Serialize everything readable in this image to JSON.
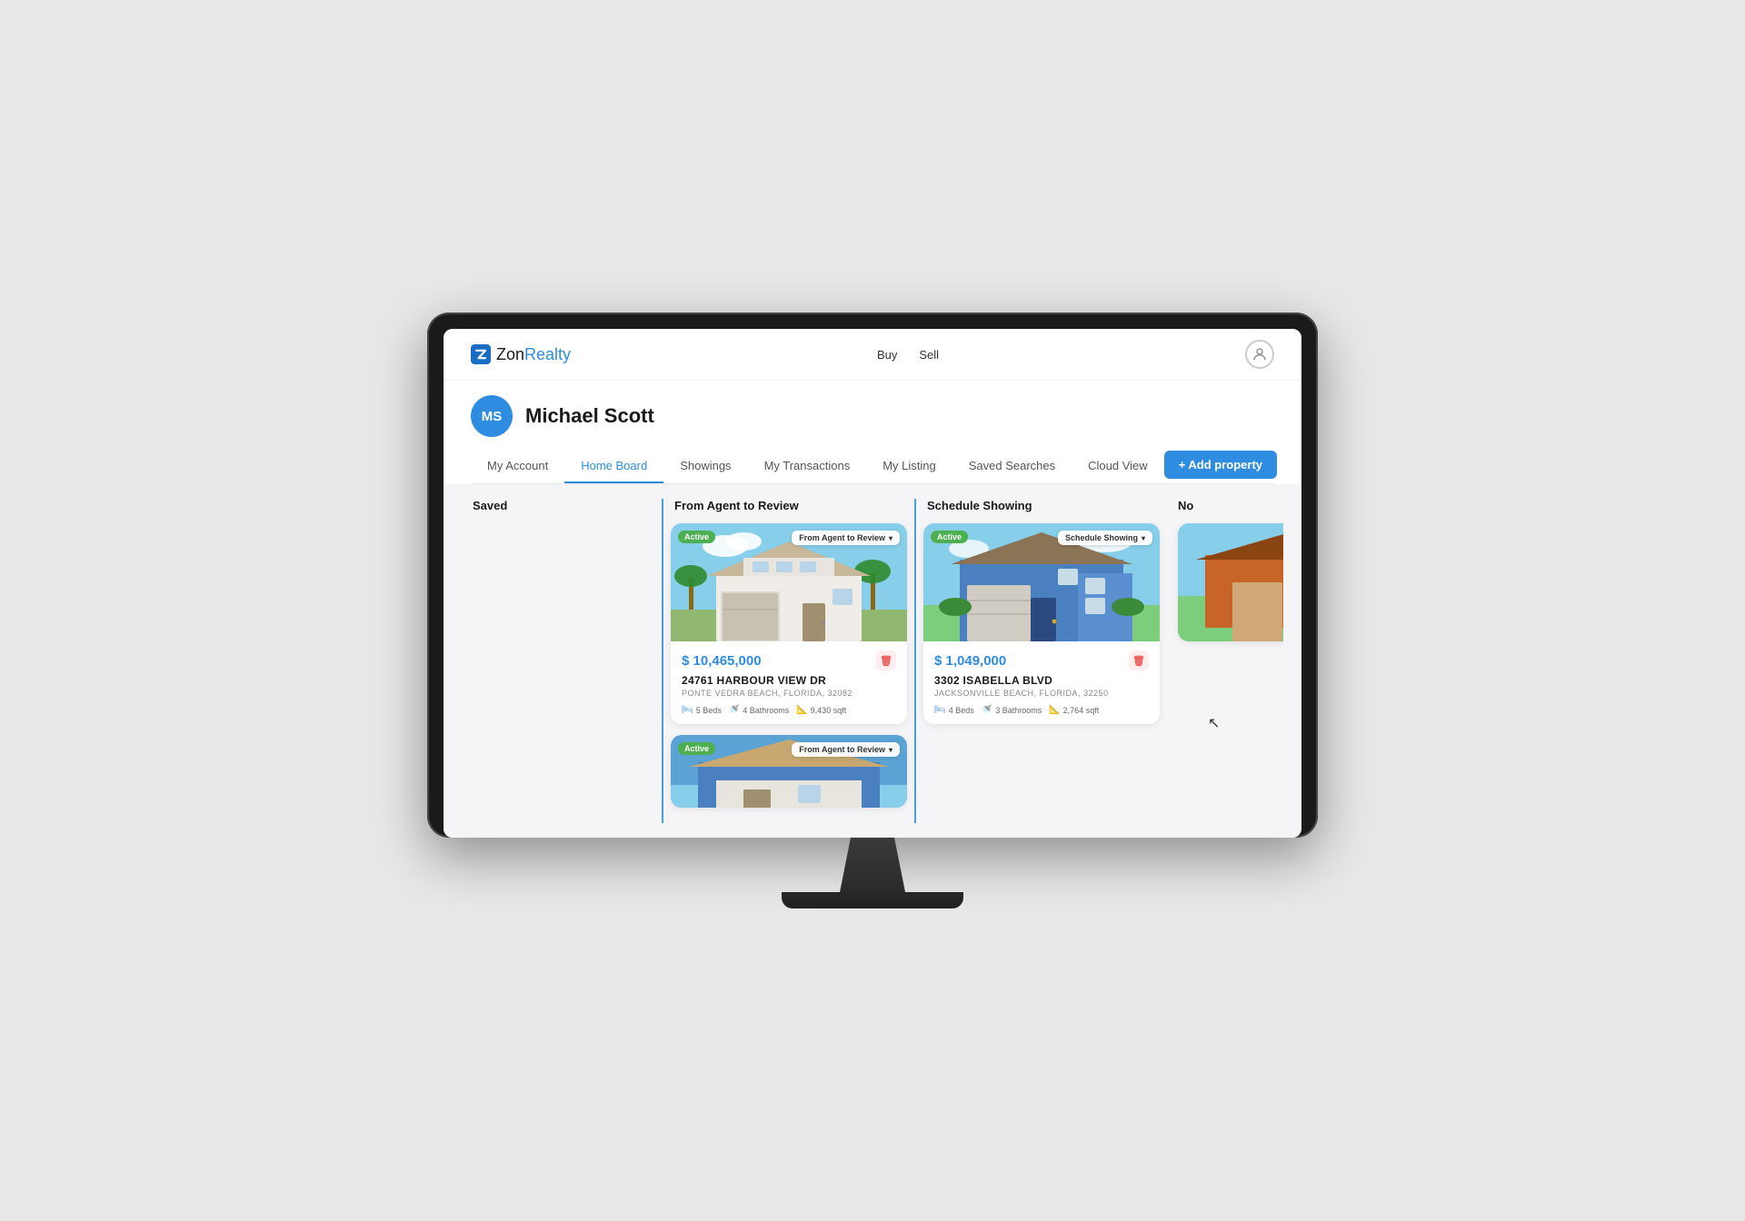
{
  "brand": {
    "name_part1": "Zon",
    "name_part2": "Realty",
    "logo_letter": "Z"
  },
  "topnav": {
    "buy_label": "Buy",
    "sell_label": "Sell"
  },
  "profile": {
    "initials": "MS",
    "name": "Michael Scott"
  },
  "subnav": {
    "items": [
      {
        "id": "my-account",
        "label": "My Account",
        "active": false
      },
      {
        "id": "home-board",
        "label": "Home Board",
        "active": true
      },
      {
        "id": "showings",
        "label": "Showings",
        "active": false
      },
      {
        "id": "my-transactions",
        "label": "My Transactions",
        "active": false
      },
      {
        "id": "my-listing",
        "label": "My Listing",
        "active": false
      },
      {
        "id": "saved-searches",
        "label": "Saved Searches",
        "active": false
      },
      {
        "id": "cloud-view",
        "label": "Cloud View",
        "active": false
      }
    ],
    "add_button": "+ Add property"
  },
  "board": {
    "columns": [
      {
        "id": "saved",
        "title": "Saved",
        "cards": []
      },
      {
        "id": "from-agent",
        "title": "From Agent to Review",
        "cards": [
          {
            "status": "Active",
            "status_label": "From Agent to Review",
            "price": "$ 10,465,000",
            "address": "24761 HARBOUR VIEW DR",
            "city": "PONTE VEDRA BEACH, FLORIDA, 32082",
            "beds": "5 Beds",
            "baths": "4 Bathrooms",
            "sqft": "9,430 sqft",
            "house_type": "luxury"
          },
          {
            "status": "Active",
            "status_label": "From Agent to Review",
            "price": "",
            "address": "",
            "city": "",
            "beds": "",
            "baths": "",
            "sqft": "",
            "house_type": "partial-bottom"
          }
        ]
      },
      {
        "id": "schedule-showing",
        "title": "Schedule Showing",
        "cards": [
          {
            "status": "Active",
            "status_label": "Schedule Showing",
            "price": "$ 1,049,000",
            "address": "3302 ISABELLA BLVD",
            "city": "JACKSONVILLE BEACH, FLORIDA, 32250",
            "beds": "4 Beds",
            "baths": "3 Bathrooms",
            "sqft": "2,764 sqft",
            "house_type": "beach"
          }
        ]
      },
      {
        "id": "no-column",
        "title": "No",
        "cards": []
      }
    ]
  }
}
